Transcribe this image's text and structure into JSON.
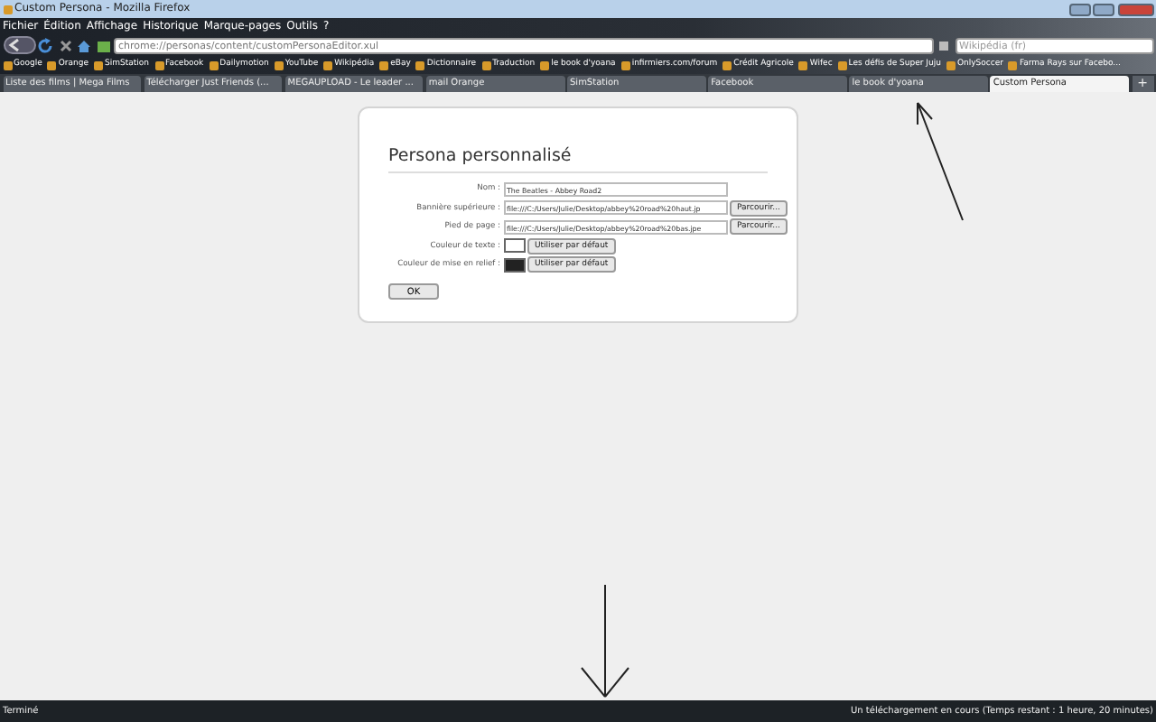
{
  "window": {
    "title": "Custom Persona - Mozilla Firefox"
  },
  "menu": [
    "Fichier",
    "Édition",
    "Affichage",
    "Historique",
    "Marque-pages",
    "Outils",
    "?"
  ],
  "nav": {
    "url": "chrome://personas/content/customPersonaEditor.xul",
    "search_placeholder": "Wikipédia (fr)"
  },
  "bookmarks": [
    "Google",
    "Orange",
    "SimStation",
    "Facebook",
    "Dailymotion",
    "YouTube",
    "Wikipédia",
    "eBay",
    "Dictionnaire",
    "Traduction",
    "le book d'yoana",
    "infirmiers.com/forum",
    "Crédit Agricole",
    "Wifec",
    "Les défis de Super Juju",
    "OnlySoccer",
    "Farma Rays sur Facebo..."
  ],
  "tabs": [
    {
      "label": "Liste des films | Mega Films",
      "selected": false
    },
    {
      "label": "Télécharger Just Friends (...",
      "selected": false
    },
    {
      "label": "MEGAUPLOAD - Le leader ...",
      "selected": false
    },
    {
      "label": "mail Orange",
      "selected": false
    },
    {
      "label": "SimStation",
      "selected": false
    },
    {
      "label": "Facebook",
      "selected": false
    },
    {
      "label": "le book d'yoana",
      "selected": false
    },
    {
      "label": "Custom Persona",
      "selected": true
    }
  ],
  "new_tab": "+",
  "dialog": {
    "title": "Persona personnalisé",
    "fields": [
      {
        "kind": "text",
        "label": "Nom :",
        "value": "The Beatles - Abbey Road2"
      },
      {
        "kind": "file",
        "label": "Bannière supérieure :",
        "value": "file:///C:/Users/Julie/Desktop/abbey%20road%20haut.jp",
        "button": "Parcourir..."
      },
      {
        "kind": "file",
        "label": "Pied de page :",
        "value": "file:///C:/Users/Julie/Desktop/abbey%20road%20bas.jpe",
        "button": "Parcourir..."
      },
      {
        "kind": "color",
        "label": "Couleur de texte :",
        "color": "#ffffff",
        "button": "Utiliser par défaut"
      },
      {
        "kind": "color",
        "label": "Couleur de mise en relief :",
        "color": "#222222",
        "button": "Utiliser par défaut"
      }
    ],
    "ok": "OK"
  },
  "status_bar": {
    "left": "Terminé",
    "right": "Un téléchargement en cours (Temps restant : 1 heure, 20 minutes)"
  }
}
